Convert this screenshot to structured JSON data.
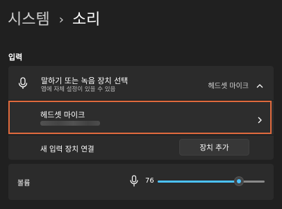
{
  "breadcrumb": {
    "parent": "시스템",
    "separator": "›",
    "current": "소리"
  },
  "input_section": {
    "title": "입력",
    "header": {
      "title": "말하기 또는 녹음 장치 선택",
      "subtitle": "앱에 자체 설정이 있을 수 있음",
      "selected_device": "헤드셋 마이크",
      "icon": "microphone-icon",
      "expand_icon": "chevron-up-icon"
    },
    "device": {
      "name": "헤드셋 마이크",
      "icon": "chevron-right-icon"
    },
    "connect": {
      "label": "새 입력 장치 연결",
      "button_label": "장치 추가"
    }
  },
  "volume": {
    "label": "볼륨",
    "value": "76",
    "level": 0.76,
    "icon": "microphone-icon"
  },
  "colors": {
    "background": "#202020",
    "card": "#2b2b2b",
    "accent": "#4cc2ff",
    "highlight_border": "#e06a3d"
  }
}
